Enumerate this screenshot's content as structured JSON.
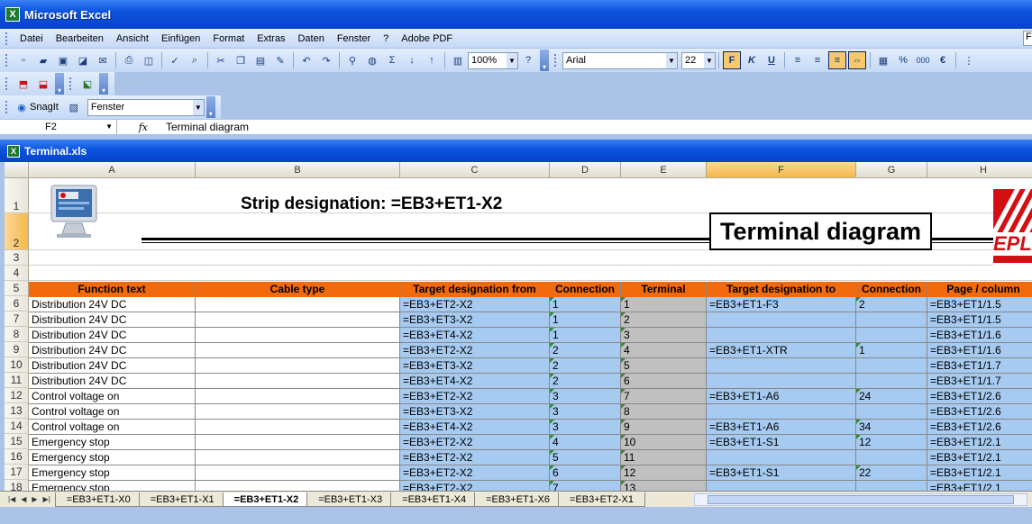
{
  "app": {
    "title": "Microsoft Excel",
    "help_box": "Fr"
  },
  "menu": [
    "Datei",
    "Bearbeiten",
    "Ansicht",
    "Einfügen",
    "Format",
    "Extras",
    "Daten",
    "Fenster",
    "?",
    "Adobe PDF"
  ],
  "toolbar": {
    "zoom": "100%",
    "font_name": "Arial",
    "font_size": "22",
    "bold_label": "F",
    "italic_label": "K",
    "underline_label": "U",
    "sum_label": "Σ",
    "percent_label": "%",
    "thousands_label": "000",
    "euro_label": "€"
  },
  "snagit": {
    "label": "SnagIt",
    "window_select": "Fenster"
  },
  "formula_bar": {
    "name_box": "F2",
    "fx": "fx",
    "value": "Terminal diagram"
  },
  "workbook": {
    "title": "Terminal.xls"
  },
  "grid": {
    "columns": [
      "A",
      "B",
      "C",
      "D",
      "E",
      "F",
      "G",
      "H"
    ],
    "selected_column": "F",
    "rows": [
      "1",
      "2",
      "3",
      "4",
      "5",
      "6",
      "7",
      "8",
      "9",
      "10",
      "11",
      "12",
      "13",
      "14",
      "15",
      "16",
      "17",
      "18"
    ],
    "selected_row": "2"
  },
  "sheet": {
    "strip_designation": "Strip designation: =EB3+ET1-X2",
    "diagram_title": "Terminal diagram",
    "logo_text": "EPLAN",
    "headers": [
      "Function text",
      "Cable type",
      "Target designation from",
      "Connection",
      "Terminal",
      "Target designation to",
      "Connection",
      "Page / column"
    ],
    "data_rows": [
      [
        "Distribution 24V DC",
        "",
        "=EB3+ET2-X2",
        "1",
        "1",
        "=EB3+ET1-F3",
        "2",
        "=EB3+ET1/1.5"
      ],
      [
        "Distribution 24V DC",
        "",
        "=EB3+ET3-X2",
        "1",
        "2",
        "",
        "",
        "=EB3+ET1/1.5"
      ],
      [
        "Distribution 24V DC",
        "",
        "=EB3+ET4-X2",
        "1",
        "3",
        "",
        "",
        "=EB3+ET1/1.6"
      ],
      [
        "Distribution 24V DC",
        "",
        "=EB3+ET2-X2",
        "2",
        "4",
        "=EB3+ET1-XTR",
        "1",
        "=EB3+ET1/1.6"
      ],
      [
        "Distribution 24V DC",
        "",
        "=EB3+ET3-X2",
        "2",
        "5",
        "",
        "",
        "=EB3+ET1/1.7"
      ],
      [
        "Distribution 24V DC",
        "",
        "=EB3+ET4-X2",
        "2",
        "6",
        "",
        "",
        "=EB3+ET1/1.7"
      ],
      [
        "Control voltage on",
        "",
        "=EB3+ET2-X2",
        "3",
        "7",
        "=EB3+ET1-A6",
        "24",
        "=EB3+ET1/2.6"
      ],
      [
        "Control voltage on",
        "",
        "=EB3+ET3-X2",
        "3",
        "8",
        "",
        "",
        "=EB3+ET1/2.6"
      ],
      [
        "Control voltage on",
        "",
        "=EB3+ET4-X2",
        "3",
        "9",
        "=EB3+ET1-A6",
        "34",
        "=EB3+ET1/2.6"
      ],
      [
        "Emergency stop",
        "",
        "=EB3+ET2-X2",
        "4",
        "10",
        "=EB3+ET1-S1",
        "12",
        "=EB3+ET1/2.1"
      ],
      [
        "Emergency stop",
        "",
        "=EB3+ET2-X2",
        "5",
        "11",
        "",
        "",
        "=EB3+ET1/2.1"
      ],
      [
        "Emergency stop",
        "",
        "=EB3+ET2-X2",
        "6",
        "12",
        "=EB3+ET1-S1",
        "22",
        "=EB3+ET1/2.1"
      ],
      [
        "Emergency stop",
        "",
        "=EB3+ET2-X2",
        "7",
        "13",
        "",
        "",
        "=EB3+ET1/2.1"
      ]
    ]
  },
  "tabs": {
    "items": [
      "=EB3+ET1-X0",
      "=EB3+ET1-X1",
      "=EB3+ET1-X2",
      "=EB3+ET1-X3",
      "=EB3+ET1-X4",
      "=EB3+ET1-X6",
      "=EB3+ET2-X1"
    ],
    "active": 2
  }
}
